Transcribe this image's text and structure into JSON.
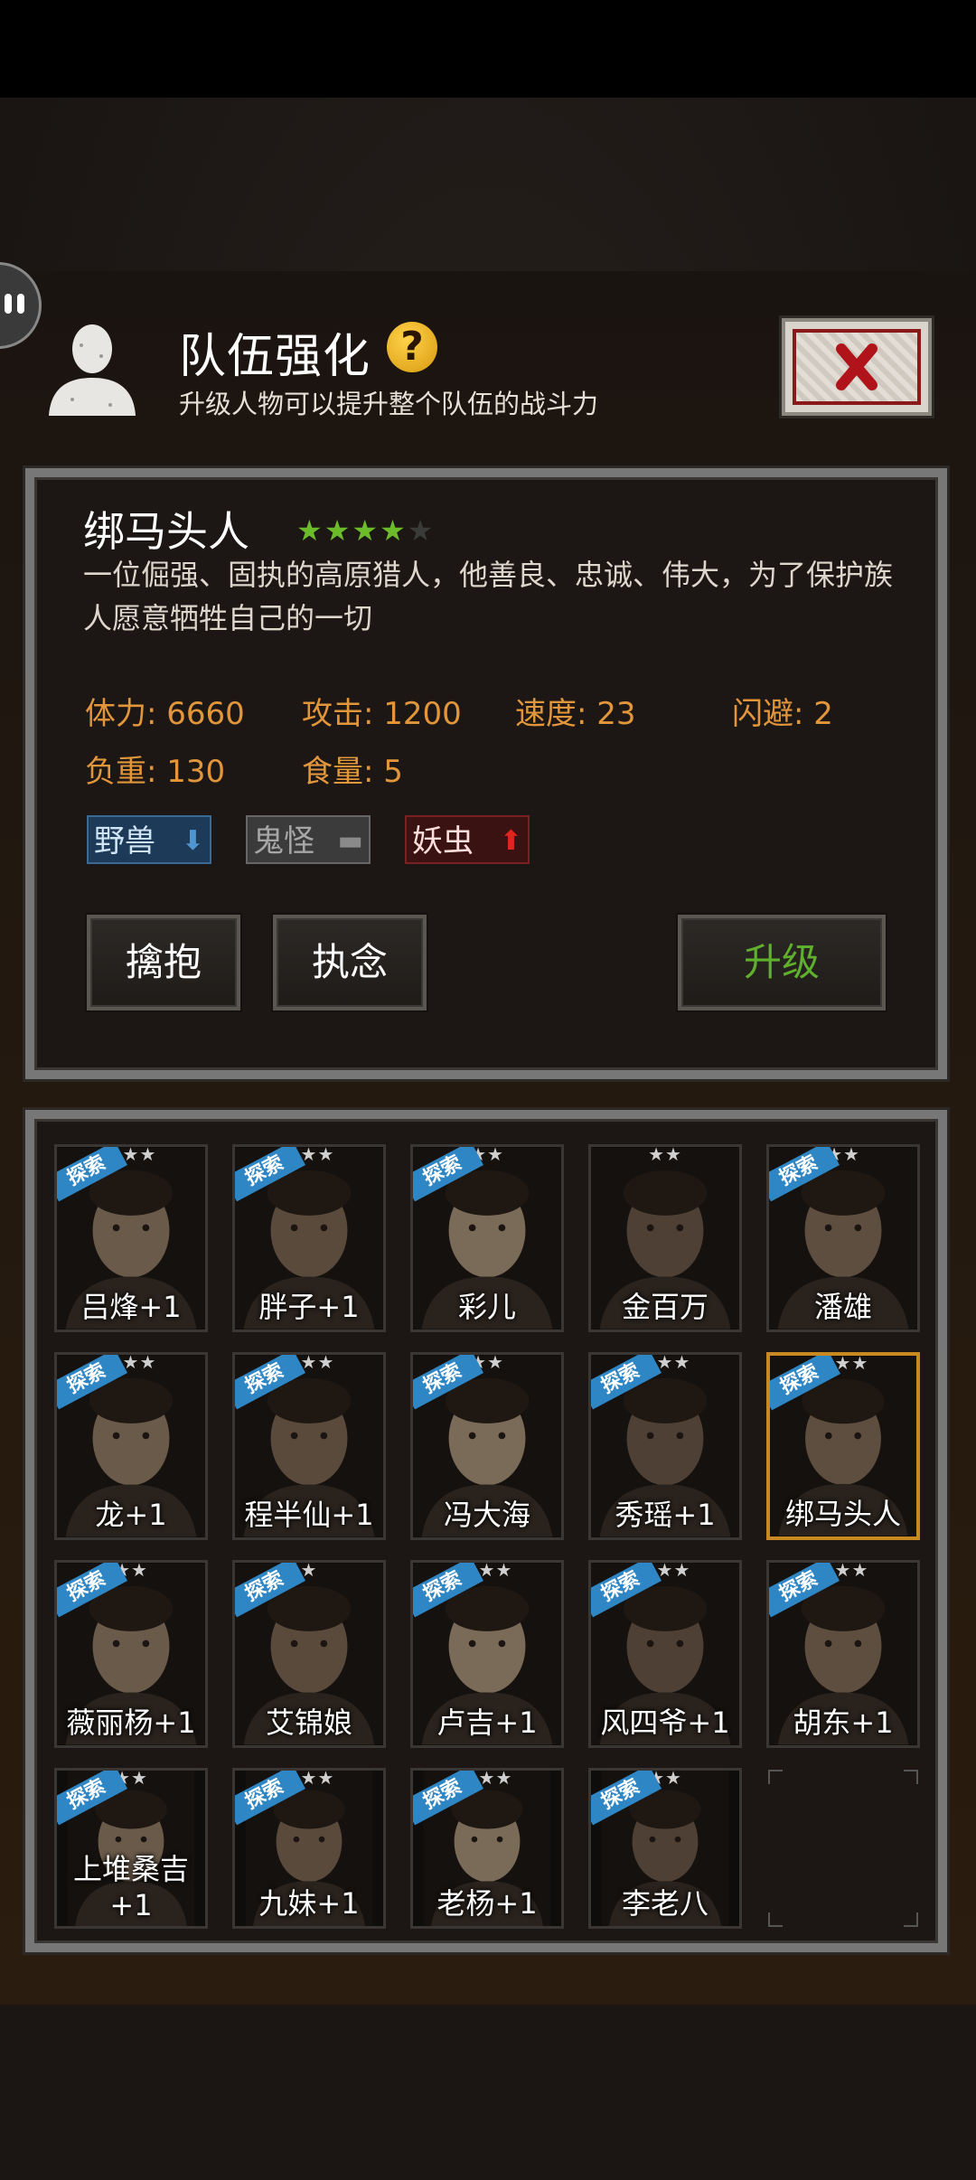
{
  "header": {
    "title": "队伍强化",
    "help_icon": "?",
    "subtitle": "升级人物可以提升整个队伍的战斗力",
    "close_icon": "close-x-icon"
  },
  "hero": {
    "name": "绑马头人",
    "stars_on": "★★★★",
    "stars_off": "★",
    "rating": 4,
    "rating_max": 5,
    "description": "一位倔强、固执的高原猎人，他善良、忠诚、伟大，为了保护族人愿意牺牲自己的一切",
    "stats": {
      "hp": "体力: 6660",
      "attack": "攻击: 1200",
      "speed": "速度: 23",
      "dodge": "闪避: 2",
      "load": "负重: 130",
      "food": "食量: 5"
    },
    "tags": {
      "beast": "野兽",
      "ghost": "鬼怪",
      "bug": "妖虫"
    },
    "buttons": {
      "capture": "擒抱",
      "obsess": "执念",
      "upgrade": "升级"
    }
  },
  "colors": {
    "accent_green": "#5fb02c",
    "stat_orange": "#e1963c",
    "selected_border": "#c88a20"
  },
  "ribbon_text": "探索",
  "characters": [
    {
      "name": "吕烽+1",
      "stars": "★★★",
      "ribbon": true
    },
    {
      "name": "胖子+1",
      "stars": "★★★",
      "ribbon": true
    },
    {
      "name": "彩儿",
      "stars": "★★",
      "ribbon": true
    },
    {
      "name": "金百万",
      "stars": "★★",
      "ribbon": false
    },
    {
      "name": "潘雄",
      "stars": "★★",
      "ribbon": true
    },
    {
      "name": "龙+1",
      "stars": "★★★",
      "ribbon": true
    },
    {
      "name": "程半仙+1",
      "stars": "★★★",
      "ribbon": true
    },
    {
      "name": "冯大海",
      "stars": "★★",
      "ribbon": true
    },
    {
      "name": "秀瑶+1",
      "stars": "★★★",
      "ribbon": true
    },
    {
      "name": "绑马头人",
      "stars": "★★★",
      "ribbon": true,
      "selected": true
    },
    {
      "name": "薇丽杨+1",
      "stars": "★★",
      "ribbon": true
    },
    {
      "name": "艾锦娘",
      "stars": "★",
      "ribbon": true
    },
    {
      "name": "卢吉+1",
      "stars": "★★★",
      "ribbon": true
    },
    {
      "name": "风四爷+1",
      "stars": "★★★",
      "ribbon": true
    },
    {
      "name": "胡东+1",
      "stars": "★★★",
      "ribbon": true
    },
    {
      "name": "上堆桑吉+1",
      "stars": "★★",
      "ribbon": true
    },
    {
      "name": "九妹+1",
      "stars": "★★★",
      "ribbon": true
    },
    {
      "name": "老杨+1",
      "stars": "★★★",
      "ribbon": true
    },
    {
      "name": "李老八",
      "stars": "★★",
      "ribbon": true
    }
  ]
}
